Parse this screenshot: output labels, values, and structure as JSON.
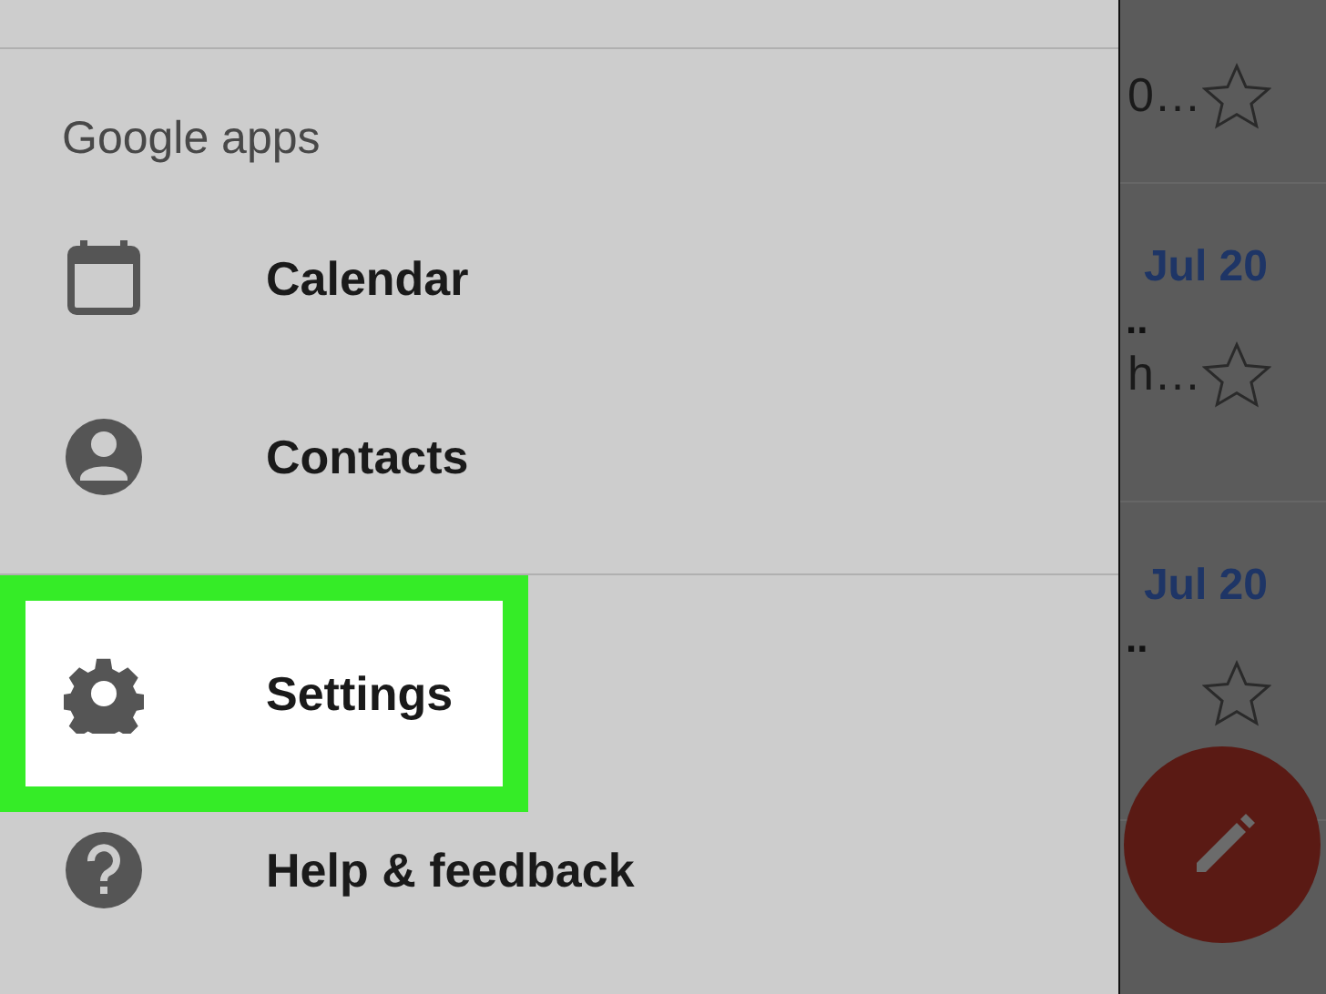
{
  "drawer": {
    "section_header": "Google apps",
    "apps": [
      {
        "label": "Calendar",
        "selected": false
      },
      {
        "label": "Contacts",
        "selected": false
      }
    ],
    "items": [
      {
        "label": "Settings",
        "selected": true
      },
      {
        "label": "Help & feedback",
        "selected": false
      }
    ]
  },
  "mail_list": [
    {
      "snippet": "0…",
      "starred": false
    },
    {
      "date": "Jul 20",
      "line": "..",
      "snippet": "h…",
      "starred": false
    },
    {
      "date": "Jul 20",
      "line": "..",
      "starred": false
    }
  ]
}
